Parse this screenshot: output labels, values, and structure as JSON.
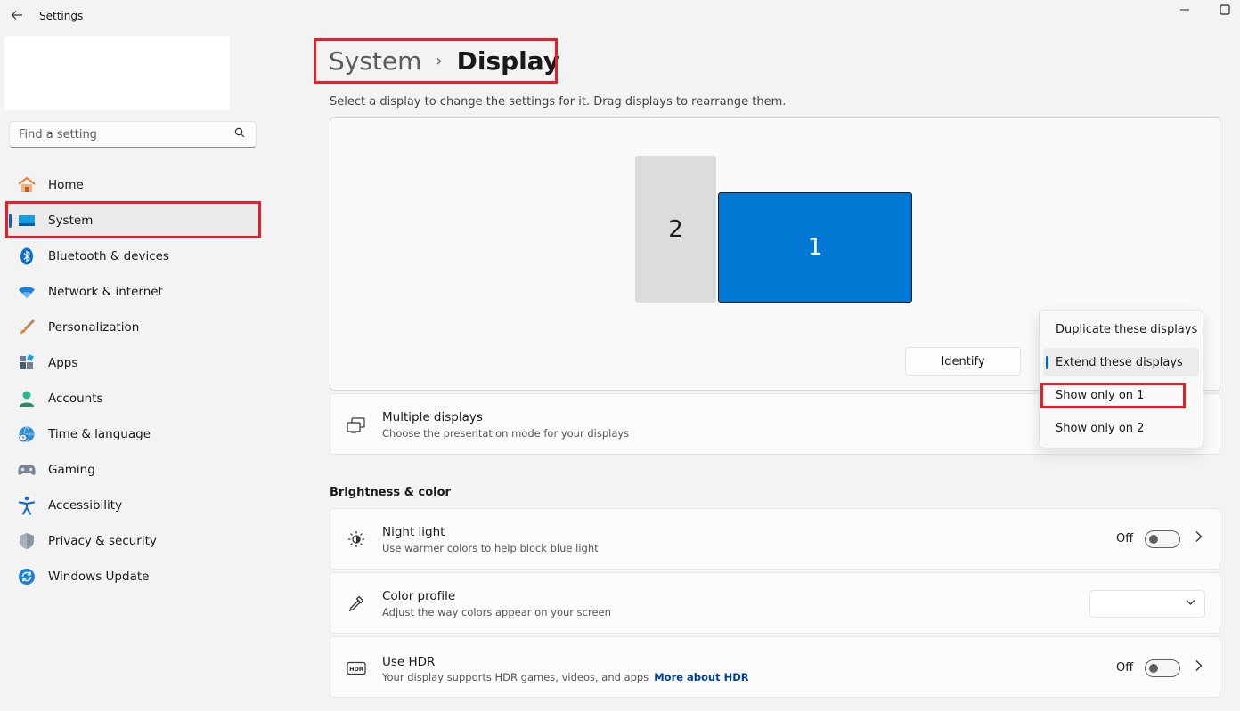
{
  "titlebar": {
    "title": "Settings"
  },
  "search": {
    "placeholder": "Find a setting"
  },
  "sidebar": {
    "items": [
      {
        "label": "Home",
        "icon": "home-icon"
      },
      {
        "label": "System",
        "icon": "system-icon",
        "active": true
      },
      {
        "label": "Bluetooth & devices",
        "icon": "bluetooth-icon"
      },
      {
        "label": "Network & internet",
        "icon": "wifi-icon"
      },
      {
        "label": "Personalization",
        "icon": "brush-icon"
      },
      {
        "label": "Apps",
        "icon": "apps-icon"
      },
      {
        "label": "Accounts",
        "icon": "accounts-icon"
      },
      {
        "label": "Time & language",
        "icon": "globe-clock-icon"
      },
      {
        "label": "Gaming",
        "icon": "gamepad-icon"
      },
      {
        "label": "Accessibility",
        "icon": "accessibility-icon"
      },
      {
        "label": "Privacy & security",
        "icon": "shield-icon"
      },
      {
        "label": "Windows Update",
        "icon": "update-icon"
      }
    ]
  },
  "header": {
    "parent": "System",
    "separator": "›",
    "current": "Display"
  },
  "display": {
    "subtitle": "Select a display to change the settings for it. Drag displays to rearrange them.",
    "monitor1": "1",
    "monitor2": "2",
    "identify_label": "Identify"
  },
  "multiple_displays": {
    "title": "Multiple displays",
    "desc": "Choose the presentation mode for your displays"
  },
  "menu": {
    "items": [
      "Duplicate these displays",
      "Extend these displays",
      "Show only on 1",
      "Show only on 2"
    ],
    "selected": "Extend these displays"
  },
  "brightness": {
    "section_title": "Brightness & color",
    "night_light": {
      "title": "Night light",
      "desc": "Use warmer colors to help block blue light",
      "state": "Off"
    },
    "color_profile": {
      "title": "Color profile",
      "desc": "Adjust the way colors appear on your screen",
      "value": ""
    },
    "hdr": {
      "title": "Use HDR",
      "desc": "Your display supports HDR games, videos, and apps",
      "link": "More about HDR",
      "state": "Off"
    }
  },
  "colors": {
    "accent": "#0067c0",
    "monitor_active": "#0078d4",
    "highlight": "#e0202b"
  }
}
